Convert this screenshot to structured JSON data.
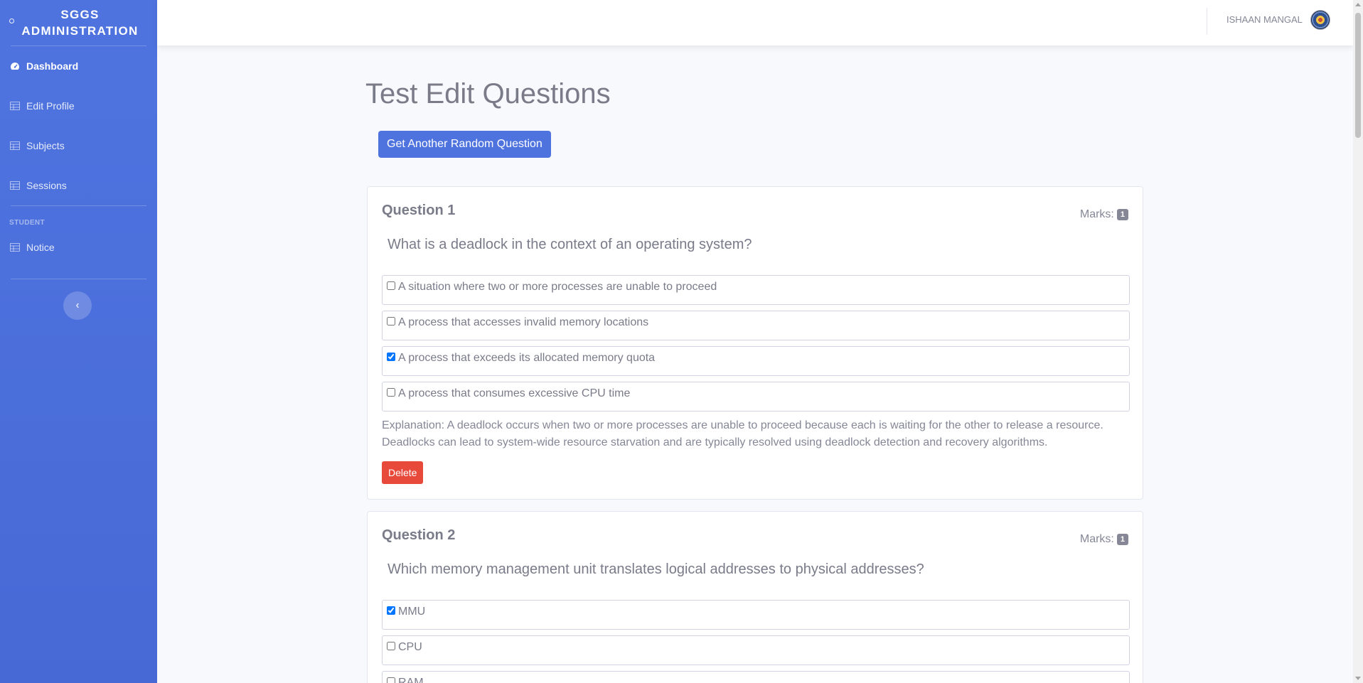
{
  "sidebar": {
    "brand_line1": "SGGS",
    "brand_line2": "ADMINISTRATION",
    "items": [
      {
        "label": "Dashboard",
        "icon": "tachometer-icon",
        "active": true
      },
      {
        "label": "Edit Profile",
        "icon": "table-icon"
      },
      {
        "label": "Subjects",
        "icon": "table-icon"
      },
      {
        "label": "Sessions",
        "icon": "table-icon"
      }
    ],
    "heading": "STUDENT",
    "student_items": [
      {
        "label": "Notice",
        "icon": "table-icon"
      }
    ],
    "toggle_icon": "chevron-left-icon",
    "toggle_glyph": "‹"
  },
  "topbar": {
    "user_name": "ISHAAN MANGAL"
  },
  "main": {
    "title": "Test Edit Questions",
    "random_button": "Get Another Random Question",
    "questions": [
      {
        "title": "Question 1",
        "marks_label": "Marks:",
        "marks": "1",
        "text": "What is a deadlock in the context of an operating system?",
        "options": [
          {
            "label": "A situation where two or more processes are unable to proceed",
            "checked": false
          },
          {
            "label": "A process that accesses invalid memory locations",
            "checked": false
          },
          {
            "label": "A process that exceeds its allocated memory quota",
            "checked": true
          },
          {
            "label": "A process that consumes excessive CPU time",
            "checked": false
          }
        ],
        "explanation": "Explanation: A deadlock occurs when two or more processes are unable to proceed because each is waiting for the other to release a resource. Deadlocks can lead to system-wide resource starvation and are typically resolved using deadlock detection and recovery algorithms.",
        "delete_label": "Delete"
      },
      {
        "title": "Question 2",
        "marks_label": "Marks:",
        "marks": "1",
        "text": "Which memory management unit translates logical addresses to physical addresses?",
        "options": [
          {
            "label": "MMU",
            "checked": true
          },
          {
            "label": "CPU",
            "checked": false
          },
          {
            "label": "RAM",
            "checked": false
          }
        ]
      }
    ]
  },
  "colors": {
    "sidebar": "#4e73df",
    "primary_button": "#4e73df",
    "danger_button": "#e74a3b",
    "page_background": "#f8f9fc"
  }
}
